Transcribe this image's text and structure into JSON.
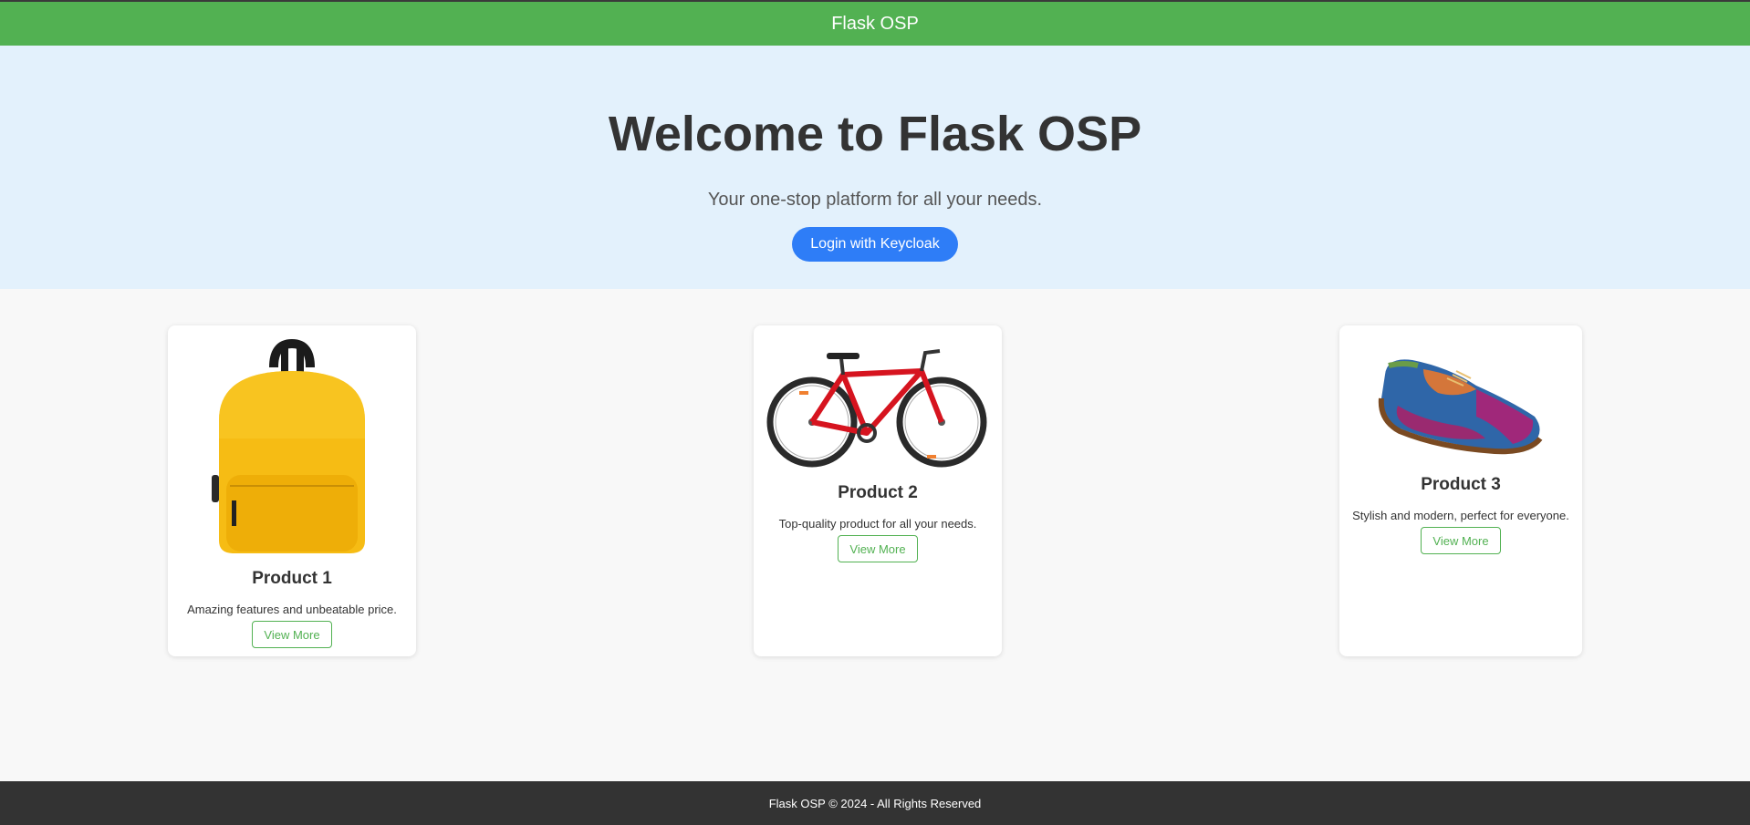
{
  "navbar": {
    "title": "Flask OSP"
  },
  "hero": {
    "heading": "Welcome to Flask OSP",
    "tagline": "Your one-stop platform for all your needs.",
    "login_label": "Login with Keycloak"
  },
  "products": [
    {
      "name": "Product 1",
      "description": "Amazing features and unbeatable price.",
      "button_label": "View More",
      "image": "yellow-backpack"
    },
    {
      "name": "Product 2",
      "description": "Top-quality product for all your needs.",
      "button_label": "View More",
      "image": "red-bicycle"
    },
    {
      "name": "Product 3",
      "description": "Stylish and modern, perfect for everyone.",
      "button_label": "View More",
      "image": "multicolor-brogue-shoe"
    }
  ],
  "footer": {
    "text": "Flask OSP © 2024 - All Rights Reserved"
  },
  "colors": {
    "navbar": "#52b152",
    "hero_bg": "#e3f1fc",
    "primary_button": "#2e7df7",
    "footer_bg": "#333333"
  }
}
